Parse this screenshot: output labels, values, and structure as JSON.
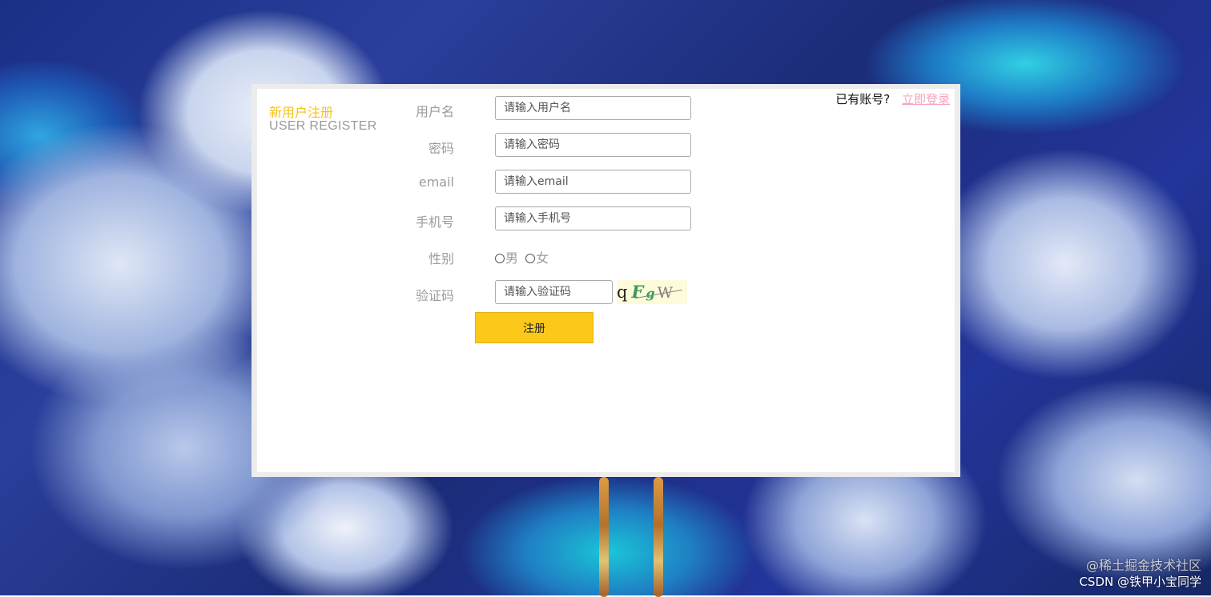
{
  "header": {
    "title_cn": "新用户注册",
    "title_en": "USER REGISTER"
  },
  "login_prompt": {
    "text": "已有账号?",
    "link_label": "立即登录"
  },
  "form": {
    "username": {
      "label": "用户名",
      "placeholder": "请输入用户名",
      "value": ""
    },
    "password": {
      "label": "密码",
      "placeholder": "请输入密码",
      "value": ""
    },
    "email": {
      "label": "email",
      "placeholder": "请输入email",
      "value": ""
    },
    "phone": {
      "label": "手机号",
      "placeholder": "请输入手机号",
      "value": ""
    },
    "gender": {
      "label": "性别",
      "options": [
        "男",
        "女"
      ],
      "selected": null
    },
    "captcha": {
      "label": "验证码",
      "placeholder": "请输入验证码",
      "value": "",
      "image_chars": [
        "q",
        "F",
        "g",
        "W"
      ]
    },
    "submit_label": "注册"
  },
  "watermark": {
    "line1": "@稀土掘金技术社区",
    "line2": "CSDN @铁甲小宝同学"
  },
  "colors": {
    "accent": "#fcc91a",
    "title_cn": "#f7c214",
    "label": "#9b9b9b",
    "link": "#f4a3be",
    "captcha_bg": "#fdfbd9"
  }
}
